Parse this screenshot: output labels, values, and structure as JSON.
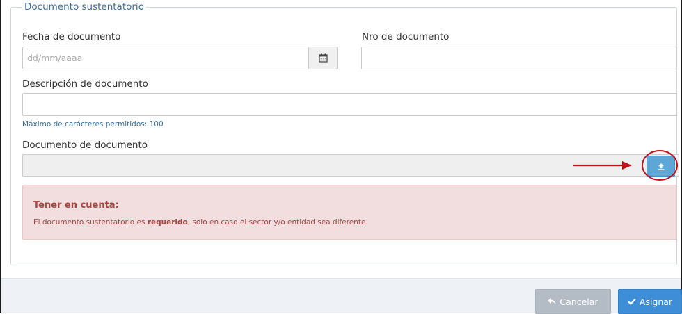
{
  "section": {
    "legend": "Documento sustentatorio"
  },
  "fields": {
    "fecha": {
      "label": "Fecha de documento",
      "placeholder": "dd/mm/aaaa",
      "value": ""
    },
    "nro": {
      "label": "Nro de documento",
      "value": ""
    },
    "descripcion": {
      "label": "Descripción de documento",
      "value": "",
      "hint": "Máximo de carácteres permitidos: 100"
    },
    "archivo": {
      "label": "Documento de documento",
      "value": ""
    }
  },
  "icons": {
    "calendar": "calendar-icon",
    "upload": "upload-icon",
    "reply": "reply-icon",
    "check": "check-icon"
  },
  "alert": {
    "title": "Tener en cuenta:",
    "text_before": "El documento sustentatorio es ",
    "text_bold": "requerido",
    "text_after": ", solo en caso el sector y/o entidad sea diferente."
  },
  "buttons": {
    "cancel_label": "Cancelar",
    "assign_label": "Asignar"
  },
  "colors": {
    "primary": "#3d8ed6",
    "upload": "#5ea6d6",
    "cancel": "#b3bcc4",
    "alert_bg": "#f2dede",
    "alert_text": "#a94442",
    "annotation": "#c0101a"
  }
}
